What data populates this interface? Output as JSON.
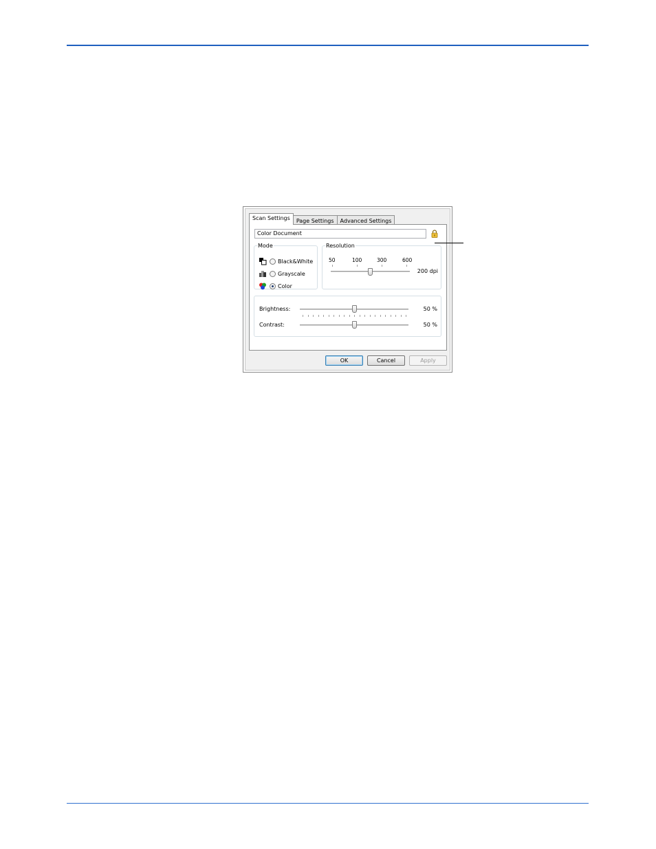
{
  "dialog": {
    "tabs": [
      {
        "label": "Scan Settings",
        "active": true
      },
      {
        "label": "Page Settings",
        "active": false
      },
      {
        "label": "Advanced Settings",
        "active": false
      }
    ],
    "profile_name": "Color Document",
    "mode": {
      "legend": "Mode",
      "options": [
        {
          "label": "Black&White",
          "selected": false
        },
        {
          "label": "Grayscale",
          "selected": false
        },
        {
          "label": "Color",
          "selected": true
        }
      ]
    },
    "resolution": {
      "legend": "Resolution",
      "ticks": [
        "50",
        "100",
        "300",
        "600"
      ],
      "value": 200,
      "value_text": "200 dpi"
    },
    "brightness": {
      "label": "Brightness:",
      "value": 50,
      "value_text": "50 %"
    },
    "contrast": {
      "label": "Contrast:",
      "value": 50,
      "value_text": "50 %"
    },
    "buttons": {
      "ok": "OK",
      "cancel": "Cancel",
      "apply": "Apply"
    }
  },
  "colors": {
    "accent_rule": "#1f5fbf",
    "default_button_border": "#3c7fb1"
  },
  "icons": [
    "lock-icon",
    "black-white-mode-icon",
    "grayscale-mode-icon",
    "color-mode-icon"
  ]
}
